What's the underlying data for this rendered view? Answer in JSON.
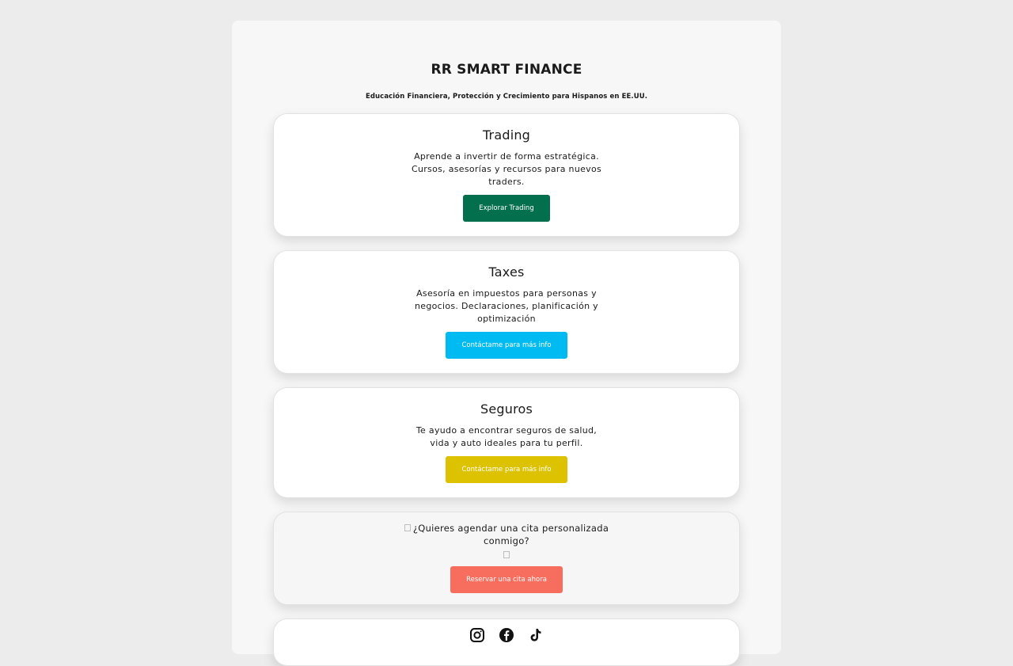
{
  "header": {
    "title": "RR SMART FINANCE",
    "subtitle": "Educación Financiera, Protección y Crecimiento para Hispanos en EE.UU."
  },
  "cards": [
    {
      "title": "Trading",
      "description": "Aprende a invertir de forma estratégica. Cursos, asesorías y recursos para nuevos traders.",
      "button_label": "Explorar Trading",
      "button_color": "#046f4d"
    },
    {
      "title": "Taxes",
      "description": "Asesoría en impuestos para personas y negocios. Declaraciones, planificación y optimización",
      "button_label": "Contáctame para más info",
      "button_color": "#00baf2"
    },
    {
      "title": "Seguros",
      "description": "Te ayudo a encontrar seguros de salud, vida y auto ideales para tu perfil.",
      "button_label": "Contáctame para más info",
      "button_color": "#dcc200"
    }
  ],
  "appointment": {
    "prompt": "¿Quieres agendar una cita personalizada conmigo?",
    "button_label": "Reservar una cita ahora",
    "button_color": "#f76e5e"
  },
  "social": {
    "icons": [
      "instagram-icon",
      "facebook-icon",
      "tiktok-icon"
    ]
  },
  "colors": {
    "page_background": "#ececec",
    "container_background": "#f7f7f7",
    "card_background": "#ffffff"
  }
}
